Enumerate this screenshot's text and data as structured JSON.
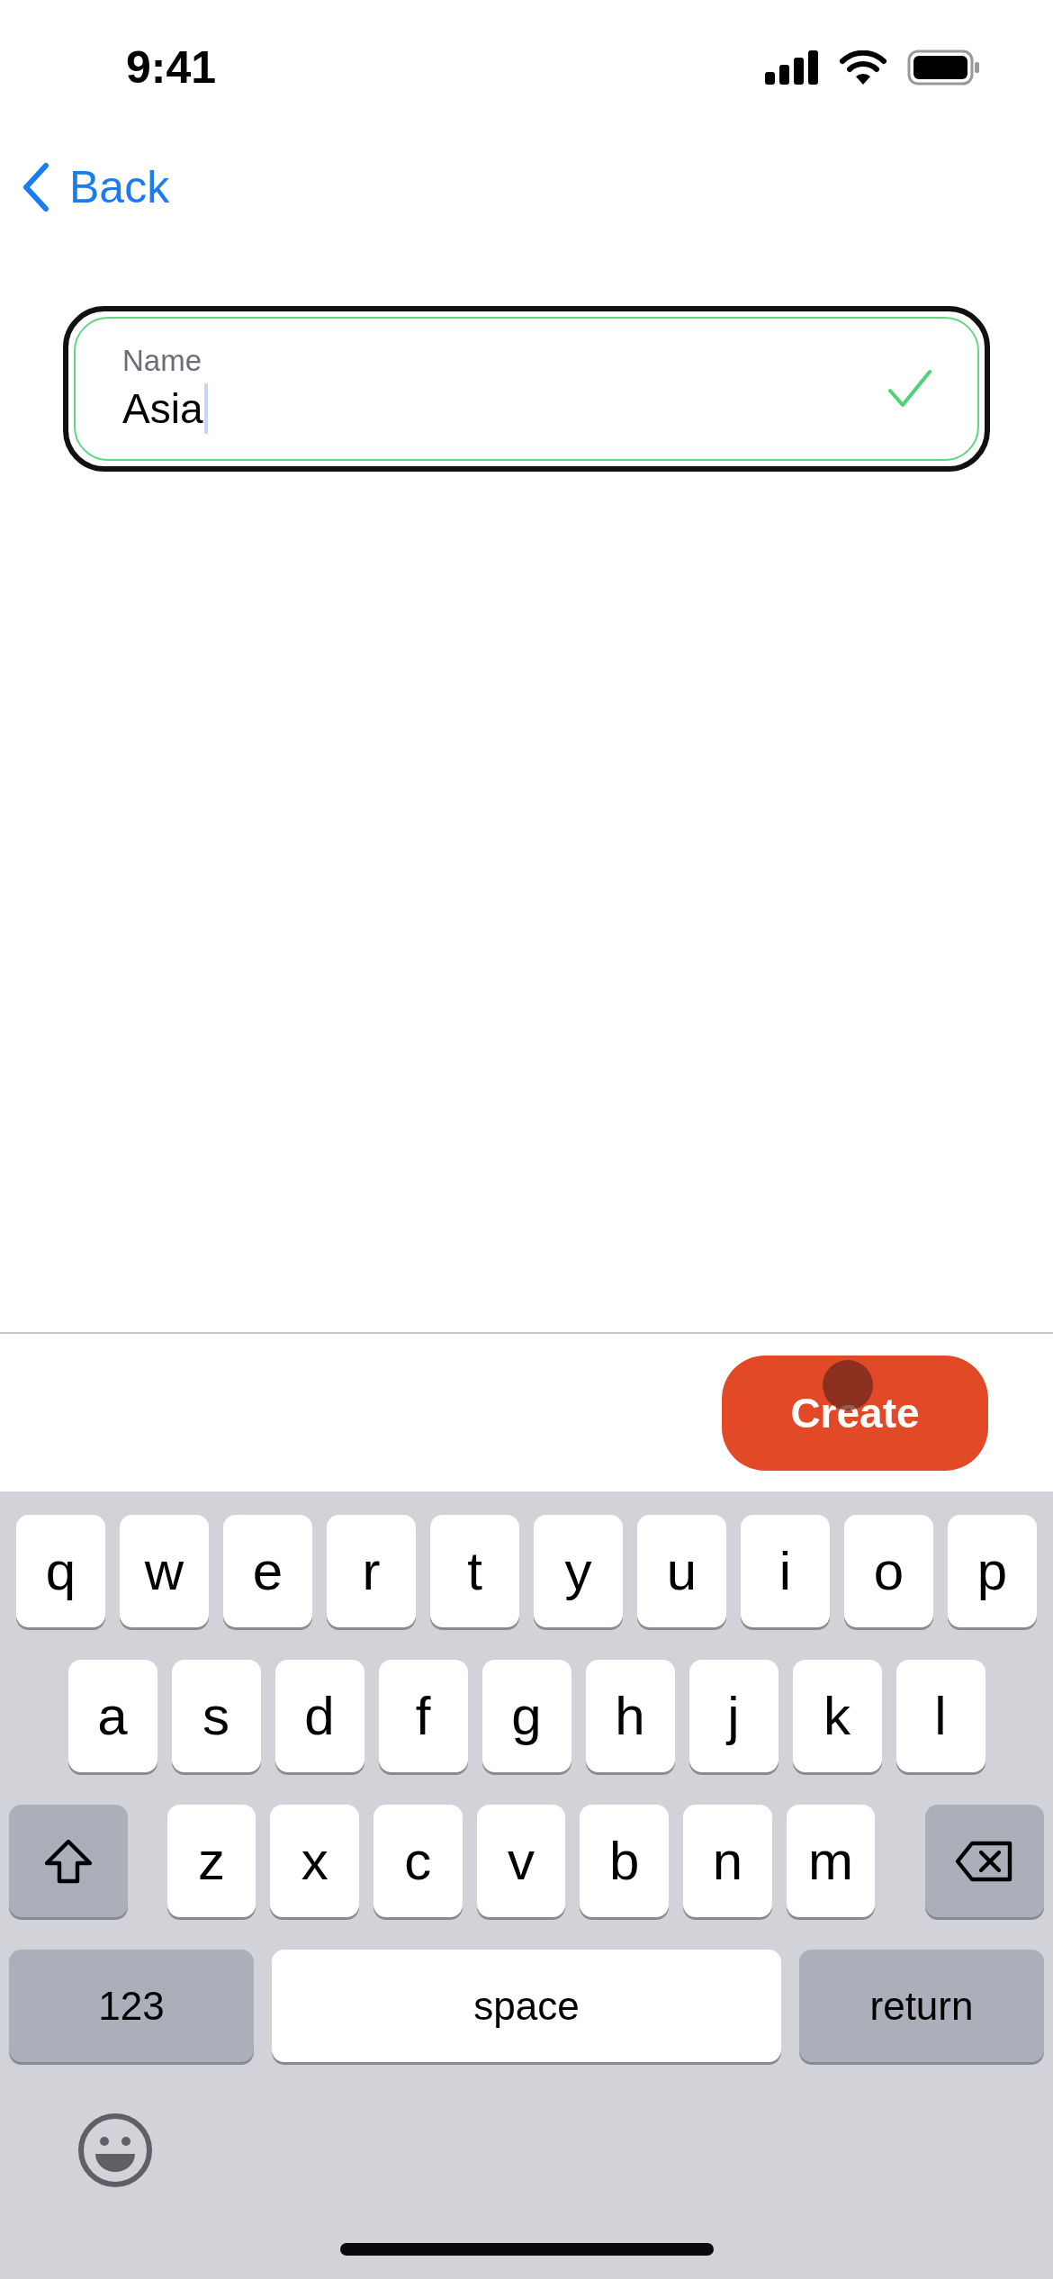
{
  "status_bar": {
    "time": "9:41"
  },
  "nav": {
    "back_label": "Back"
  },
  "name_field": {
    "label": "Name",
    "value": "Asia",
    "focused": true,
    "valid": true
  },
  "action_button": {
    "label": "Create",
    "pressed": true
  },
  "keyboard": {
    "rows": [
      {
        "keys": [
          {
            "kind": "letter",
            "label": "q"
          },
          {
            "kind": "letter",
            "label": "w"
          },
          {
            "kind": "letter",
            "label": "e"
          },
          {
            "kind": "letter",
            "label": "r"
          },
          {
            "kind": "letter",
            "label": "t"
          },
          {
            "kind": "letter",
            "label": "y"
          },
          {
            "kind": "letter",
            "label": "u"
          },
          {
            "kind": "letter",
            "label": "i"
          },
          {
            "kind": "letter",
            "label": "o"
          },
          {
            "kind": "letter",
            "label": "p"
          }
        ]
      },
      {
        "keys": [
          {
            "kind": "letter",
            "label": "a"
          },
          {
            "kind": "letter",
            "label": "s"
          },
          {
            "kind": "letter",
            "label": "d"
          },
          {
            "kind": "letter",
            "label": "f"
          },
          {
            "kind": "letter",
            "label": "g"
          },
          {
            "kind": "letter",
            "label": "h"
          },
          {
            "kind": "letter",
            "label": "j"
          },
          {
            "kind": "letter",
            "label": "k"
          },
          {
            "kind": "letter",
            "label": "l"
          }
        ]
      },
      {
        "keys": [
          {
            "kind": "shift"
          },
          {
            "kind": "letter",
            "label": "z"
          },
          {
            "kind": "letter",
            "label": "x"
          },
          {
            "kind": "letter",
            "label": "c"
          },
          {
            "kind": "letter",
            "label": "v"
          },
          {
            "kind": "letter",
            "label": "b"
          },
          {
            "kind": "letter",
            "label": "n"
          },
          {
            "kind": "letter",
            "label": "m"
          },
          {
            "kind": "delete"
          }
        ]
      }
    ],
    "bottom": {
      "numbers": "123",
      "space": "space",
      "return": "return"
    }
  }
}
